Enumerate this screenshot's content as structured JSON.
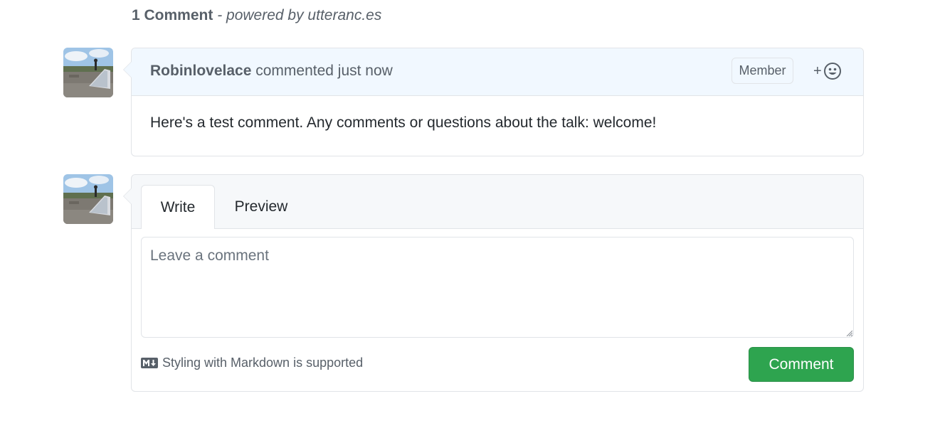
{
  "header": {
    "count": "1 Comment",
    "powered_by": "- powered by utteranc.es"
  },
  "comments": [
    {
      "author": "Robinlovelace",
      "action": "commented",
      "time": "just now",
      "badge": "Member",
      "reaction_plus": "+",
      "body": "Here's a test comment. Any comments or questions about the talk: welcome!"
    }
  ],
  "form": {
    "tabs": [
      {
        "label": "Write",
        "active": true
      },
      {
        "label": "Preview",
        "active": false
      }
    ],
    "placeholder": "Leave a comment",
    "markdown_hint": "Styling with Markdown is supported",
    "submit_label": "Comment"
  },
  "colors": {
    "accent_green": "#2ea44f",
    "header_blue": "#f1f8ff",
    "border": "#e1e4e8",
    "muted_text": "#586069"
  },
  "icons": {
    "reaction": "smiley-icon",
    "markdown": "markdown-icon",
    "avatar": "avatar-photo"
  }
}
